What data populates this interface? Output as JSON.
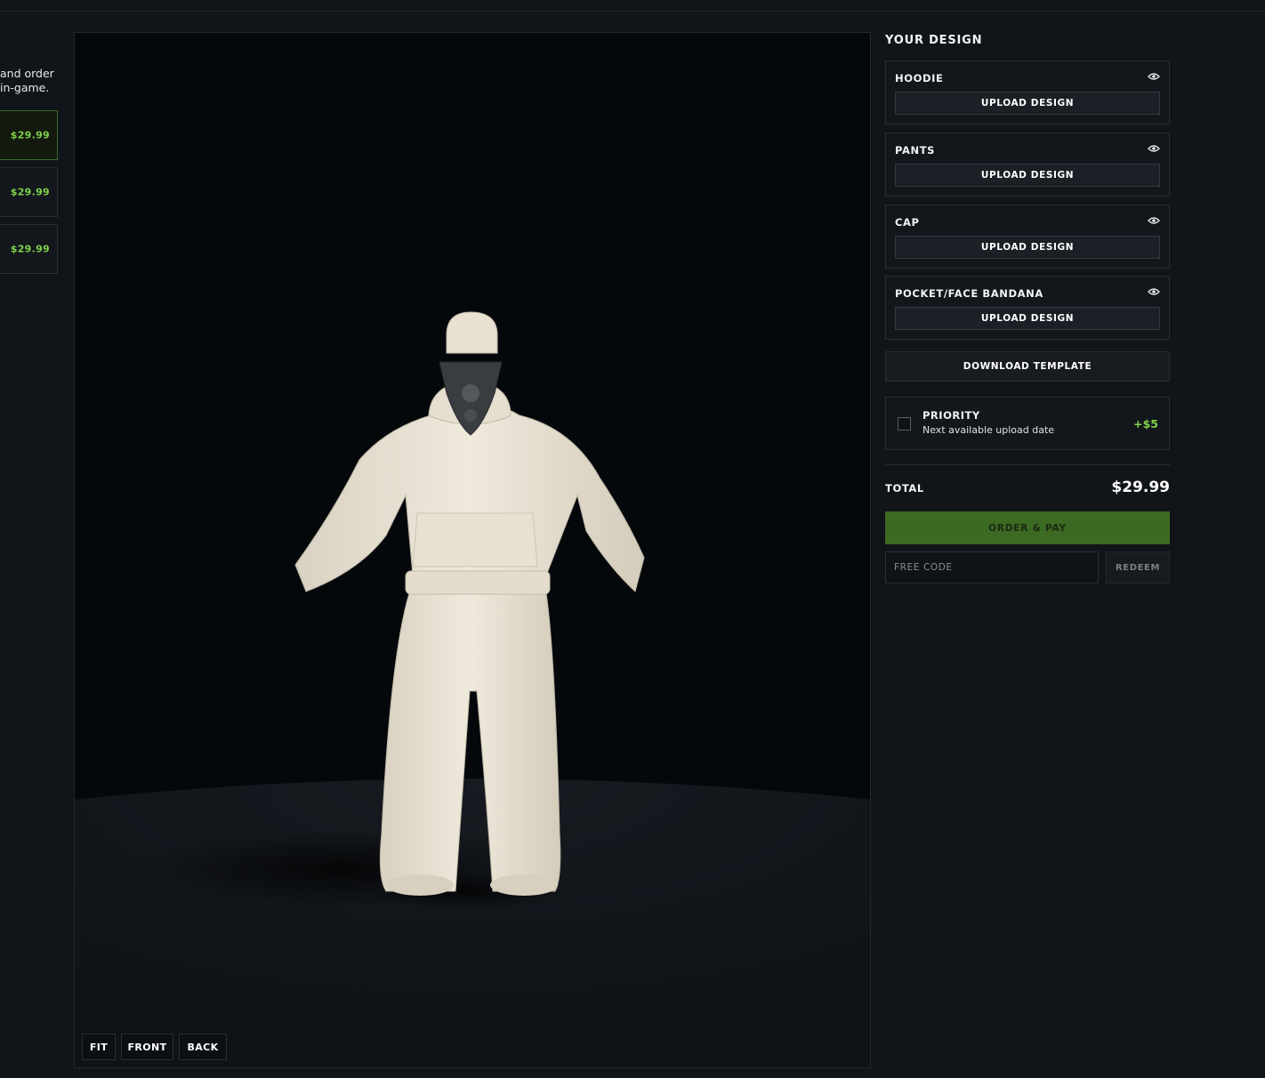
{
  "left_panel": {
    "description_lines": [
      "and order",
      "in-game."
    ],
    "cards": [
      {
        "price": "$29.99",
        "selected": true
      },
      {
        "price": "$29.99",
        "selected": false
      },
      {
        "price": "$29.99",
        "selected": false
      }
    ]
  },
  "viewer": {
    "buttons": {
      "fit": "FIT",
      "front": "FRONT",
      "back": "BACK"
    }
  },
  "design": {
    "title": "YOUR DESIGN",
    "slots": [
      {
        "label": "HOODIE",
        "upload_label": "UPLOAD DESIGN",
        "icon": "eye-icon"
      },
      {
        "label": "PANTS",
        "upload_label": "UPLOAD DESIGN",
        "icon": "eye-icon"
      },
      {
        "label": "CAP",
        "upload_label": "UPLOAD DESIGN",
        "icon": "eye-icon"
      },
      {
        "label": "POCKET/FACE BANDANA",
        "upload_label": "UPLOAD DESIGN",
        "icon": "eye-icon"
      }
    ],
    "download_template": "DOWNLOAD TEMPLATE",
    "priority": {
      "title": "PRIORITY",
      "subtitle": "Next available upload date",
      "price": "+$5",
      "checked": false
    },
    "total_label": "TOTAL",
    "total_value": "$29.99",
    "order_button": "ORDER & PAY",
    "free_code_placeholder": "FREE CODE",
    "redeem_button": "REDEEM"
  },
  "colors": {
    "accent_green": "#7ed24a",
    "order_green": "#3c6a22",
    "background": "#111419"
  }
}
